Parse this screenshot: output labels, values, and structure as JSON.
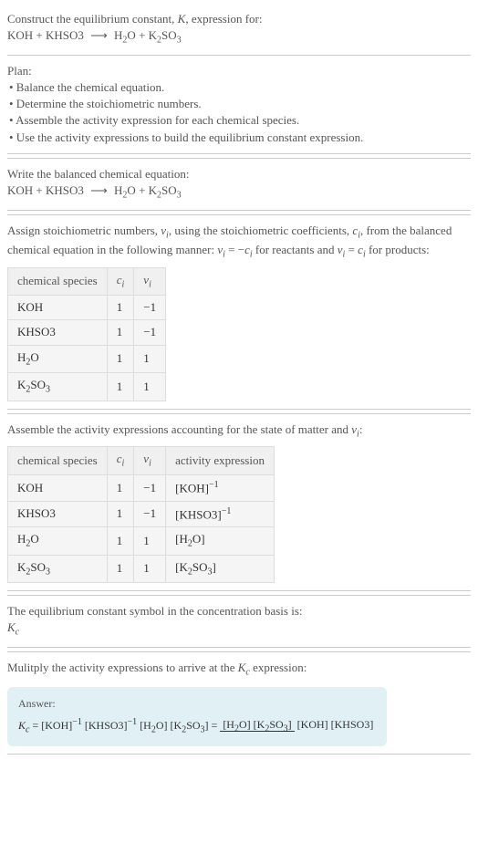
{
  "top": {
    "prompt_line1": "Construct the equilibrium constant, ",
    "prompt_K": "K",
    "prompt_line1b": ", expression for:",
    "eq_lhs": "KOH + KHSO3",
    "arrow": "⟶",
    "eq_rhs_h2o": "H",
    "eq_rhs_k2so3": "K",
    "sub2": "2",
    "O": "O",
    "SO": "SO",
    "sub3": "3",
    "plus": " + "
  },
  "plan": {
    "title": "Plan:",
    "items": [
      "• Balance the chemical equation.",
      "• Determine the stoichiometric numbers.",
      "• Assemble the activity expression for each chemical species.",
      "• Use the activity expressions to build the equilibrium constant expression."
    ]
  },
  "balanced": {
    "title": "Write the balanced chemical equation:",
    "lhs": "KOH + KHSO3",
    "arrow": "⟶"
  },
  "stoich": {
    "intro_a": "Assign stoichiometric numbers, ",
    "nu": "ν",
    "sub_i": "i",
    "intro_b": ", using the stoichiometric coefficients, ",
    "c": "c",
    "intro_c": ", from the balanced chemical equation in the following manner: ",
    "rel1a": " = −",
    "rel1b": " for reactants and ",
    "rel2a": " = ",
    "rel2b": " for products:",
    "headers": {
      "sp": "chemical species",
      "ci": "c",
      "nui": "ν"
    },
    "rows": [
      {
        "sp": "KOH",
        "ci": "1",
        "nui": "−1"
      },
      {
        "sp": "KHSO3",
        "ci": "1",
        "nui": "−1"
      },
      {
        "sp": "H2O",
        "ci": "1",
        "nui": "1"
      },
      {
        "sp": "K2SO3",
        "ci": "1",
        "nui": "1"
      }
    ]
  },
  "activity": {
    "intro_a": "Assemble the activity expressions accounting for the state of matter and ",
    "colon": ":",
    "headers": {
      "sp": "chemical species",
      "ci": "c",
      "nui": "ν",
      "act": "activity expression"
    },
    "rows": [
      {
        "sp": "KOH",
        "ci": "1",
        "nui": "−1",
        "act": "[KOH]",
        "exp": "−1"
      },
      {
        "sp": "KHSO3",
        "ci": "1",
        "nui": "−1",
        "act": "[KHSO3]",
        "exp": "−1"
      },
      {
        "sp": "H2O",
        "ci": "1",
        "nui": "1",
        "act": "[H2O]",
        "exp": ""
      },
      {
        "sp": "K2SO3",
        "ci": "1",
        "nui": "1",
        "act": "[K2SO3]",
        "exp": ""
      }
    ]
  },
  "symbol": {
    "text": "The equilibrium constant symbol in the concentration basis is:",
    "Kc": "K",
    "sub_c": "c"
  },
  "multiply": {
    "text_a": "Mulitply the activity expressions to arrive at the ",
    "text_b": " expression:"
  },
  "answer": {
    "label": "Answer:",
    "Kc": "K",
    "sub_c": "c",
    "eq": " = [KOH]",
    "neg1": "−1",
    "khso3": " [KHSO3]",
    "h2o": " [H",
    "o_close": "O] ",
    "k2so3": "[K",
    "so3_close": "SO",
    "close": "]",
    "eq2": " = ",
    "num": "[H2O] [K2SO3]",
    "den": "[KOH] [KHSO3]"
  }
}
